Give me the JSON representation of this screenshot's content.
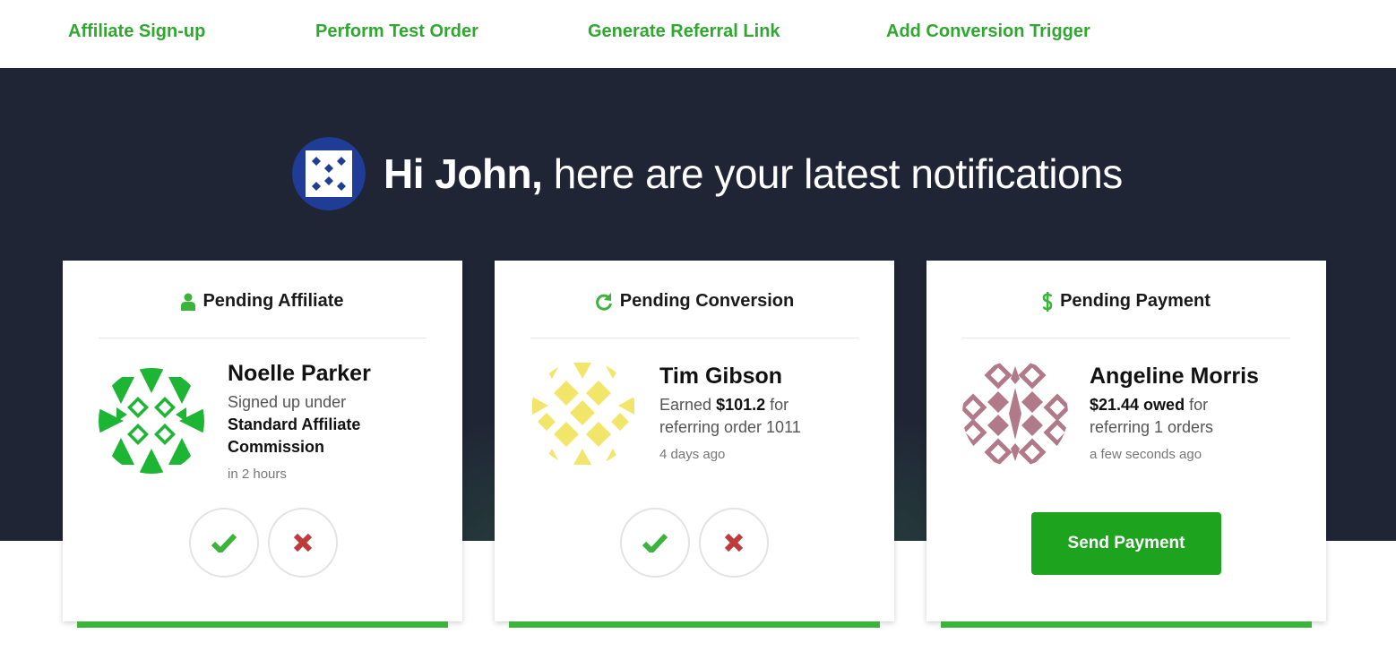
{
  "nav": {
    "items": [
      "Affiliate Sign-up",
      "Perform Test Order",
      "Generate Referral Link",
      "Add Conversion Trigger"
    ]
  },
  "greeting": {
    "name": "Hi John,",
    "text": " here are your latest notifications"
  },
  "cards": [
    {
      "title": "Pending Affiliate",
      "icon": "user-icon",
      "person_name": "Noelle Parker",
      "desc_prefix": "Signed up under",
      "desc_strong": "Standard Affiliate Commission",
      "time": "in 2 hours",
      "avatar_color": "#1db534"
    },
    {
      "title": "Pending Conversion",
      "icon": "refresh-icon",
      "person_name": "Tim Gibson",
      "desc_prefix": "Earned",
      "desc_strong": "$101.2",
      "desc_suffix": "for referring order 1011",
      "time": "4 days ago",
      "avatar_color": "#f2e66a"
    },
    {
      "title": "Pending Payment",
      "icon": "dollar-icon",
      "person_name": "Angeline Morris",
      "desc_strong": "$21.44 owed",
      "desc_suffix": "for referring 1 orders",
      "time": "a few seconds ago",
      "button": "Send Payment",
      "avatar_color": "#b07a8a"
    }
  ],
  "colors": {
    "accent": "#3cb43c",
    "hero_bg": "#202536",
    "approve": "#3cb43c",
    "reject": "#c0393b"
  }
}
